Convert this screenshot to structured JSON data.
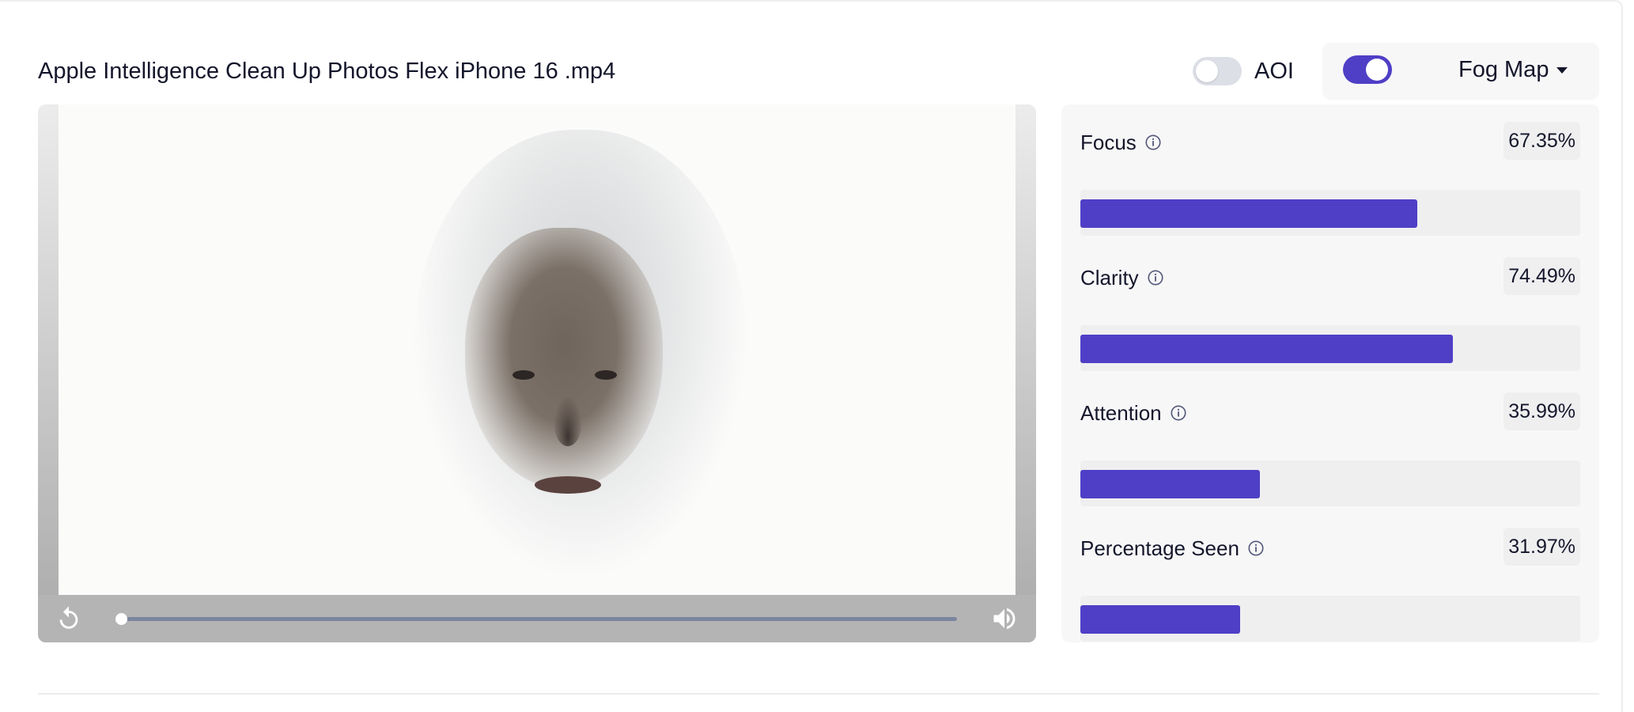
{
  "header": {
    "title": "Apple Intelligence Clean Up Photos Flex iPhone 16 .mp4"
  },
  "aoi": {
    "label": "AOI",
    "enabled": false
  },
  "fog_map": {
    "enabled": true,
    "label": "Fog Map",
    "icon": "caret-down-icon"
  },
  "player": {
    "progress_fraction": 0.0,
    "controls": {
      "replay_icon": "replay-icon",
      "volume_icon": "volume-icon"
    }
  },
  "metrics": [
    {
      "label": "Focus",
      "value": "67.35%",
      "fraction": 0.6735,
      "icon": "info-icon"
    },
    {
      "label": "Clarity",
      "value": "74.49%",
      "fraction": 0.7449,
      "icon": "info-icon"
    },
    {
      "label": "Attention",
      "value": "35.99%",
      "fraction": 0.3599,
      "icon": "info-icon"
    },
    {
      "label": "Percentage Seen",
      "value": "31.97%",
      "fraction": 0.3197,
      "icon": "info-icon"
    }
  ],
  "colors": {
    "accent": "#4f3fc6",
    "toggle_off": "#dcdfe6"
  }
}
